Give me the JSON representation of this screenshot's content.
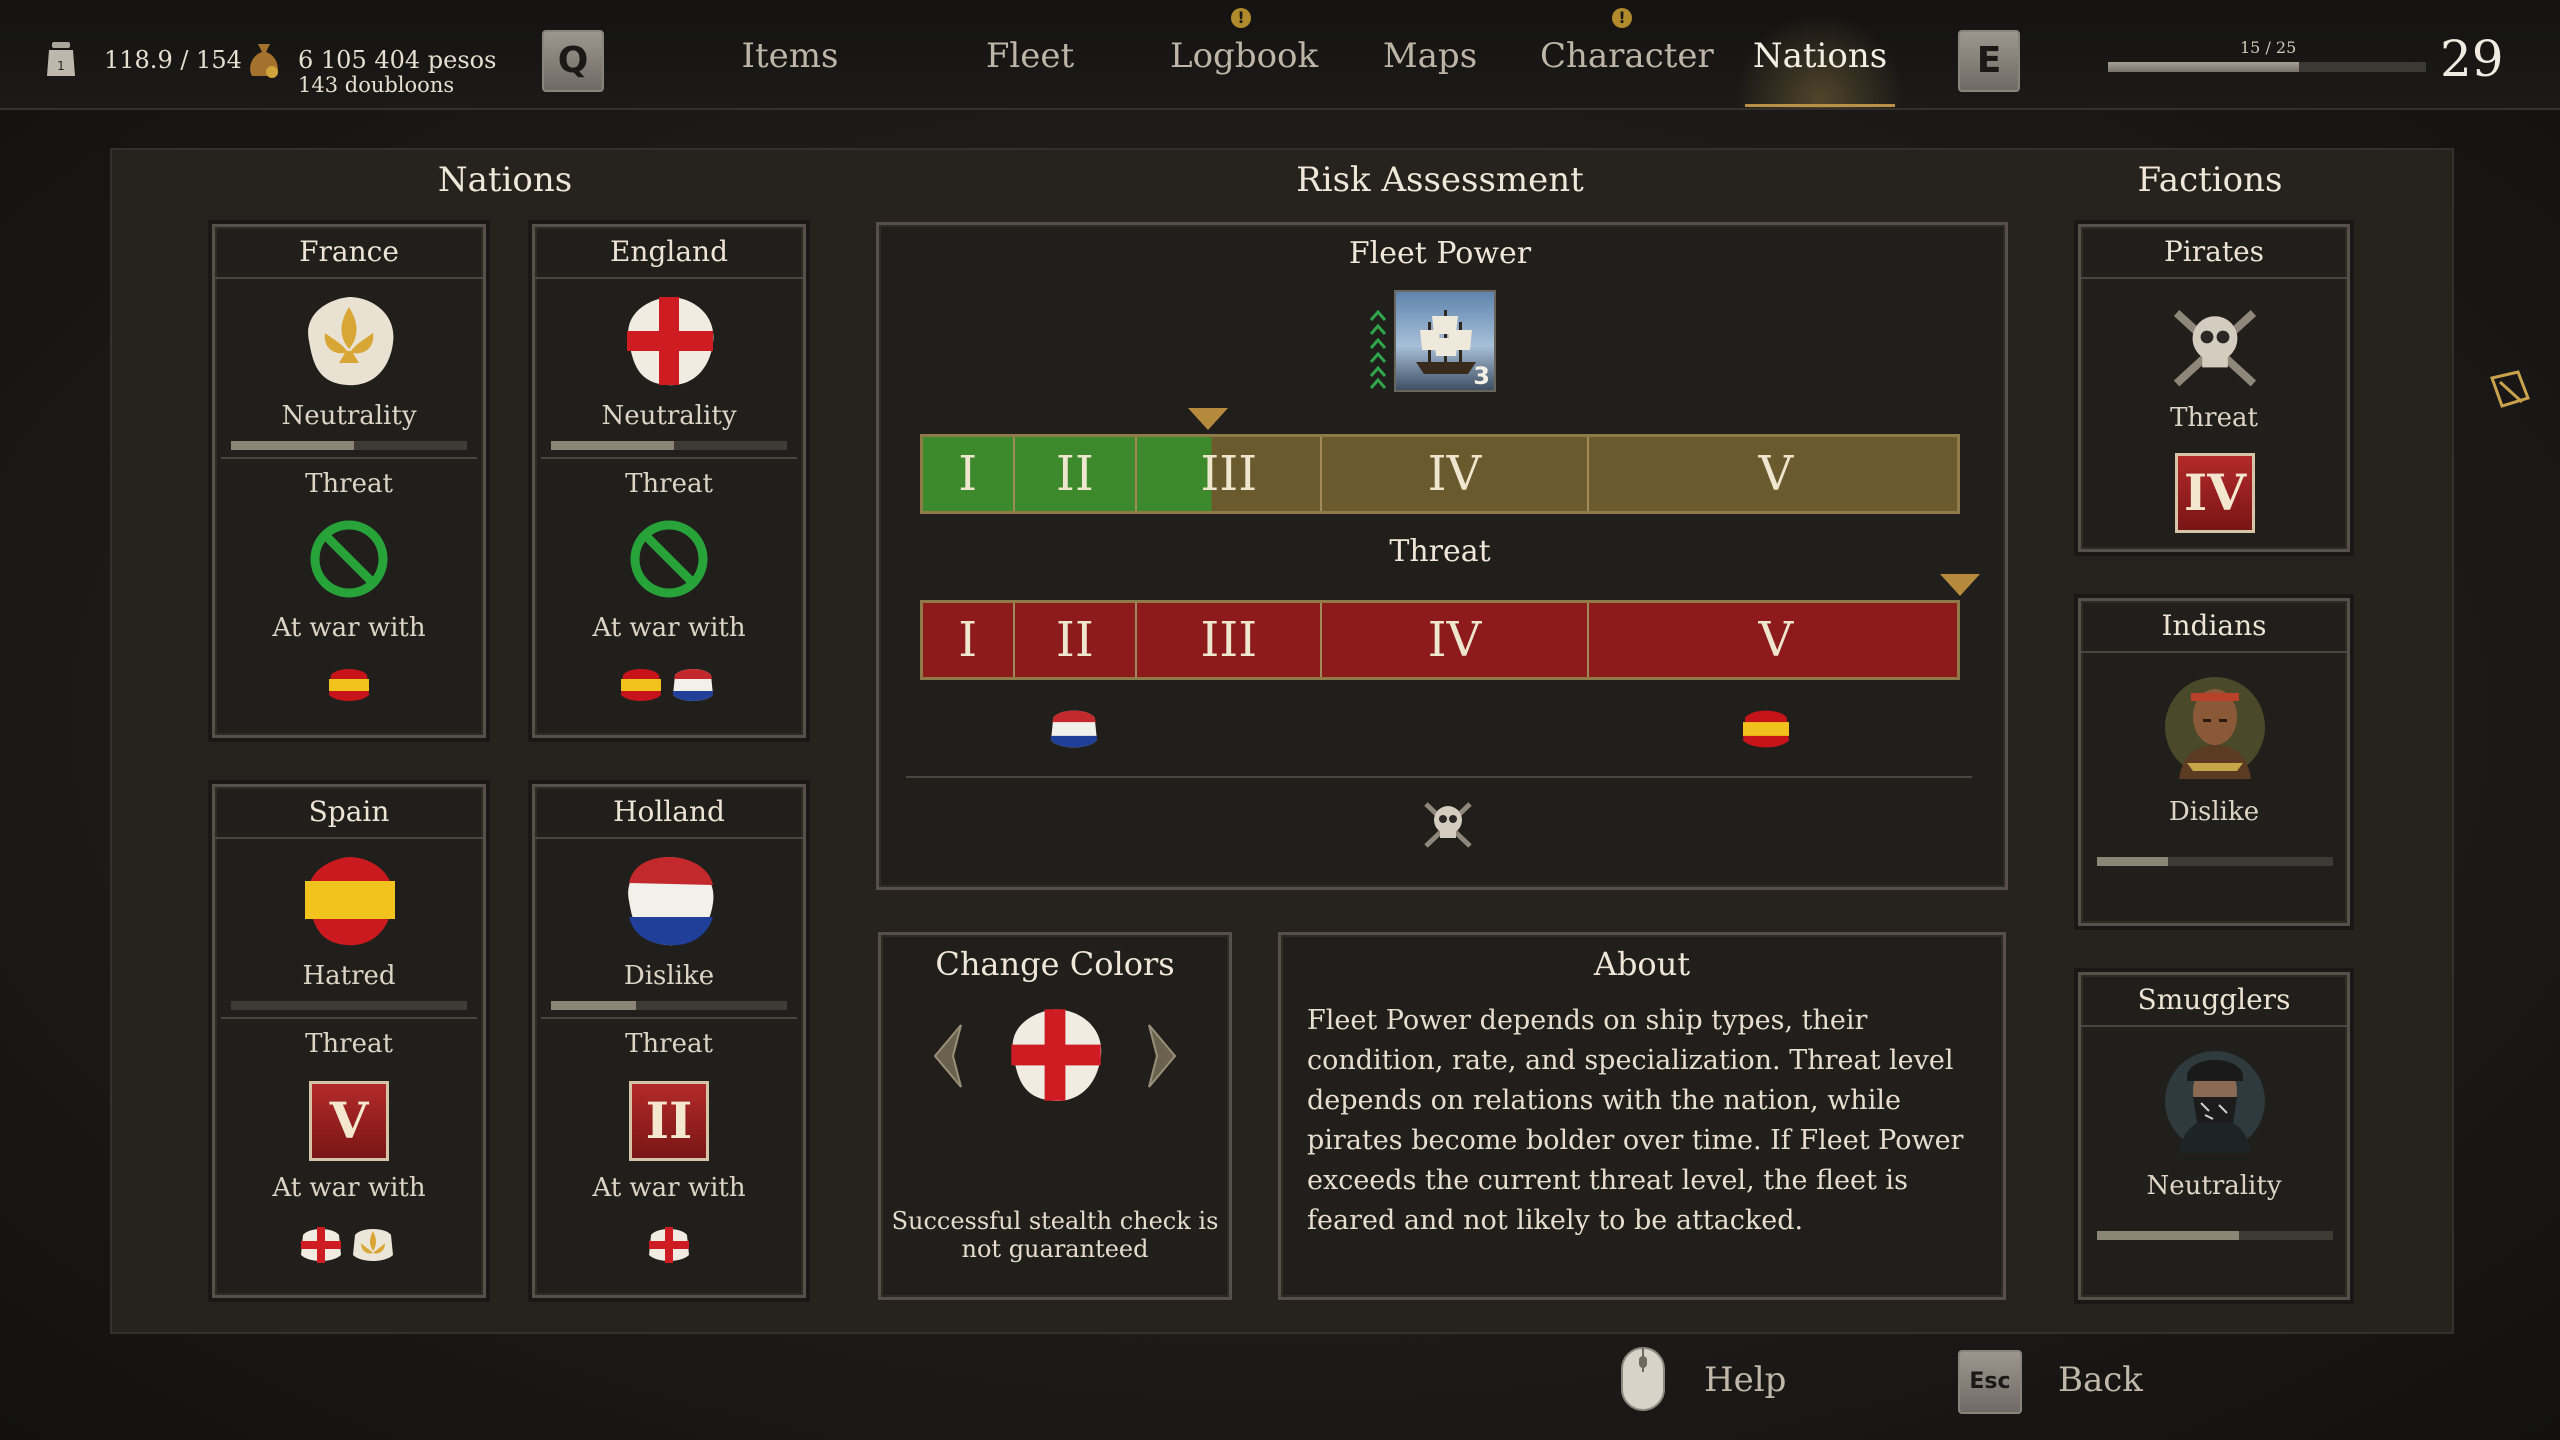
{
  "topbar": {
    "weight": "118.9 / 154",
    "money_pesos": "6 105 404 pesos",
    "money_doubloons": "143 doubloons",
    "key_left": "Q",
    "key_right": "E",
    "tabs": [
      {
        "label": "Items",
        "alert": false,
        "active": false
      },
      {
        "label": "Fleet",
        "alert": false,
        "active": false
      },
      {
        "label": "Logbook",
        "alert": true,
        "active": false
      },
      {
        "label": "Maps",
        "alert": false,
        "active": false
      },
      {
        "label": "Character",
        "alert": true,
        "active": false
      },
      {
        "label": "Nations",
        "alert": false,
        "active": true
      }
    ],
    "xp_text": "15 / 25",
    "xp_progress": 0.6,
    "level": "29"
  },
  "nations": {
    "title": "Nations",
    "threat_label": "Threat",
    "war_label": "At war with",
    "cards": [
      {
        "name": "France",
        "relation": "Neutrality",
        "relation_level": 0.52,
        "threat": "none",
        "at_war_with": [
          "spain"
        ]
      },
      {
        "name": "England",
        "relation": "Neutrality",
        "relation_level": 0.52,
        "threat": "none",
        "at_war_with": [
          "spain",
          "holland"
        ]
      },
      {
        "name": "Spain",
        "relation": "Hatred",
        "relation_level": 0.0,
        "threat": "V",
        "at_war_with": [
          "england",
          "france"
        ]
      },
      {
        "name": "Holland",
        "relation": "Dislike",
        "relation_level": 0.36,
        "threat": "II",
        "at_war_with": [
          "england"
        ]
      }
    ]
  },
  "risk": {
    "title": "Risk Assessment",
    "fleet_power_label": "Fleet Power",
    "threat_label": "Threat",
    "ship_count": "3",
    "levels": [
      "I",
      "II",
      "III",
      "IV",
      "V"
    ],
    "fleet_power_level": 2.4,
    "threat_marker_level": 5,
    "colors": {
      "green": "#3d8a2c",
      "gold": "#6b5a2e",
      "red": "#8e1b1b"
    }
  },
  "change_colors": {
    "title": "Change Colors",
    "note": "Successful stealth check is not guaranteed"
  },
  "about": {
    "title": "About",
    "text": "Fleet Power depends on ship types, their condition, rate, and specialization. Threat level depends on relations with the nation, while pirates become bolder over time. If Fleet Power exceeds the current threat level, the fleet is feared and not likely to be attacked."
  },
  "factions": {
    "title": "Factions",
    "pirates": {
      "name": "Pirates",
      "label": "Threat",
      "threat": "IV"
    },
    "indians": {
      "name": "Indians",
      "relation": "Dislike",
      "relation_level": 0.3
    },
    "smugglers": {
      "name": "Smugglers",
      "relation": "Neutrality",
      "relation_level": 0.6
    }
  },
  "footer": {
    "help_label": "Help",
    "back_label": "Back",
    "back_key": "Esc"
  }
}
